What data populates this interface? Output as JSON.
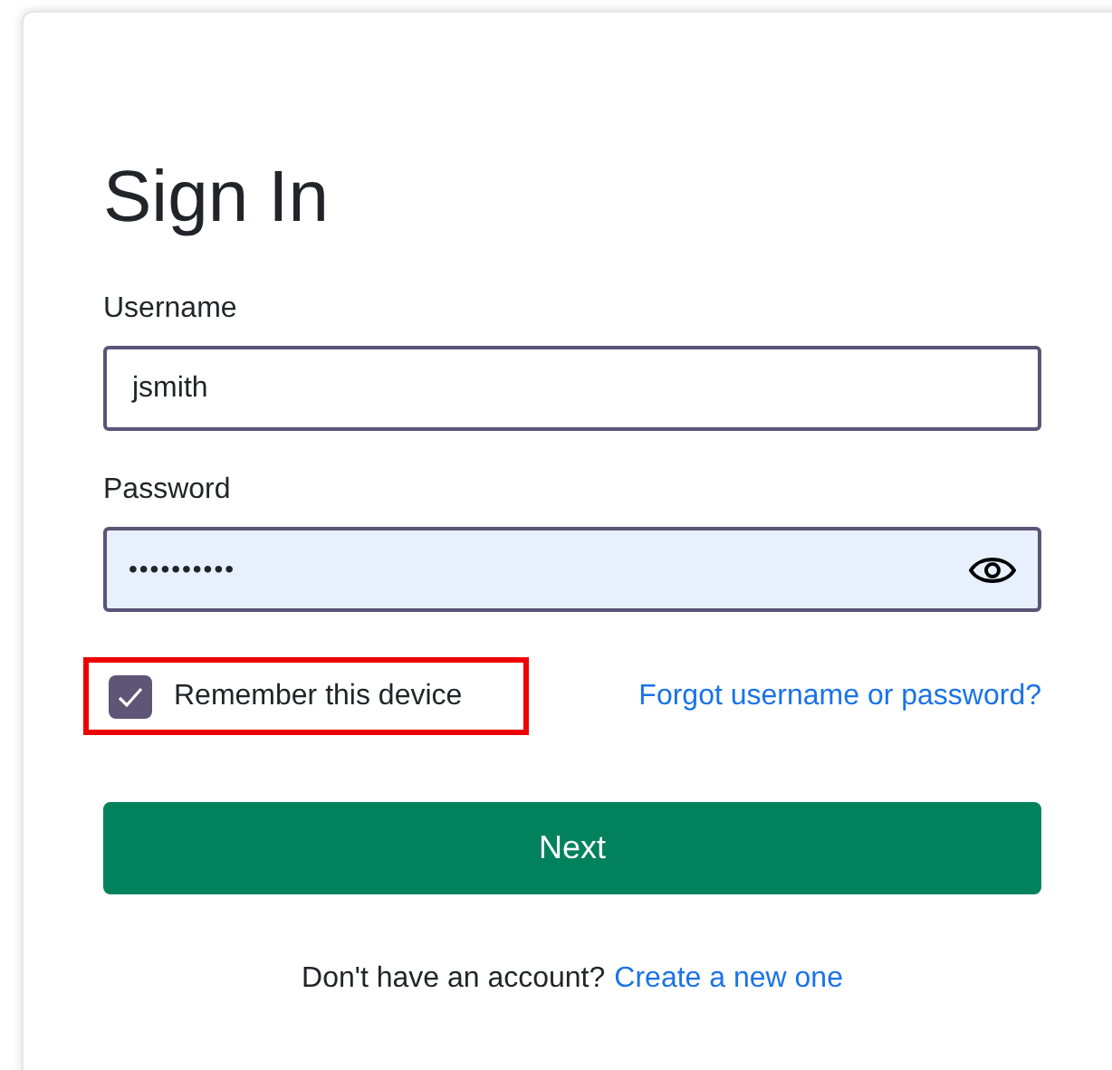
{
  "title": "Sign In",
  "username": {
    "label": "Username",
    "value": "jsmith"
  },
  "password": {
    "label": "Password",
    "value": "••••••••••",
    "autofilled": true
  },
  "remember": {
    "label": "Remember this device",
    "checked": true,
    "highlighted": true
  },
  "forgot_link": "Forgot username or password?",
  "next_button": "Next",
  "signup": {
    "text": "Don't have an account?",
    "link": "Create a new one"
  }
}
